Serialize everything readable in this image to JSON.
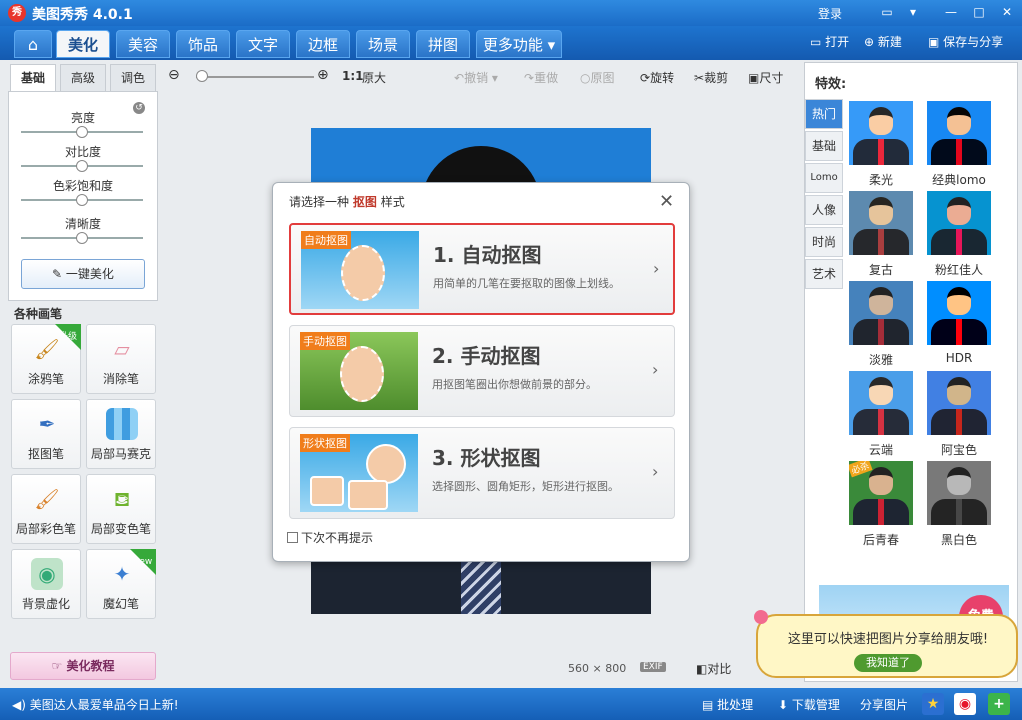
{
  "window": {
    "logo": "秀",
    "title": "美图秀秀 4.0.1",
    "login": "登录",
    "icons": [
      "message-icon",
      "dropdown-icon",
      "minimize-icon",
      "maximize-icon",
      "close-icon"
    ]
  },
  "tabs": [
    {
      "label": "⌂"
    },
    {
      "label": "美化"
    },
    {
      "label": "美容"
    },
    {
      "label": "饰品"
    },
    {
      "label": "文字"
    },
    {
      "label": "边框"
    },
    {
      "label": "场景"
    },
    {
      "label": "拼图"
    },
    {
      "label": "更多功能"
    }
  ],
  "top_actions": {
    "open": "打开",
    "new": "新建",
    "save_share": "保存与分享"
  },
  "toolbar": {
    "ratio": "1:1",
    "original_size": "原大",
    "undo": "撤销",
    "redo": "重做",
    "original": "原图",
    "rotate": "旋转",
    "crop": "裁剪",
    "size": "尺寸",
    "zoom_level": 0.05
  },
  "left": {
    "subtabs": [
      "基础",
      "高级",
      "调色"
    ],
    "adjustments": [
      {
        "label": "亮度",
        "value": 0.5
      },
      {
        "label": "对比度",
        "value": 0.5
      },
      {
        "label": "色彩饱和度",
        "value": 0.5
      },
      {
        "label": "清晰度",
        "value": 0.5
      }
    ],
    "onekey": "一键美化",
    "brush_title": "各种画笔",
    "brushes": [
      {
        "label": "涂鸦笔",
        "badge": "升级"
      },
      {
        "label": "消除笔",
        "badge": ""
      },
      {
        "label": "抠图笔",
        "badge": ""
      },
      {
        "label": "局部马赛克",
        "badge": ""
      },
      {
        "label": "局部彩色笔",
        "badge": ""
      },
      {
        "label": "局部变色笔",
        "badge": ""
      },
      {
        "label": "背景虚化",
        "badge": ""
      },
      {
        "label": "魔幻笔",
        "badge": "new"
      }
    ],
    "tutorial": "美化教程"
  },
  "canvas": {
    "width": "560",
    "times": "×",
    "height": "800",
    "exif": "EXIF",
    "compare": "对比"
  },
  "dialog": {
    "title_pre": "请选择一种",
    "title_hl": "抠图",
    "title_post": "样式",
    "options": [
      {
        "tag": "自动抠图",
        "title": "1. 自动抠图",
        "desc": "用简单的几笔在要抠取的图像上划线。"
      },
      {
        "tag": "手动抠图",
        "title": "2. 手动抠图",
        "desc": "用抠图笔圈出你想做前景的部分。"
      },
      {
        "tag": "形状抠图",
        "title": "3. 形状抠图",
        "desc": "选择圆形、圆角矩形，矩形进行抠图。"
      }
    ],
    "checkbox": "下次不再提示"
  },
  "right": {
    "title": "特效:",
    "categories": [
      "热门",
      "基础",
      "Lomo",
      "人像",
      "时尚",
      "艺术"
    ],
    "effects": [
      {
        "label": "柔光",
        "badge": ""
      },
      {
        "label": "经典lomo",
        "badge": ""
      },
      {
        "label": "复古",
        "badge": ""
      },
      {
        "label": "粉红佳人",
        "badge": ""
      },
      {
        "label": "淡雅",
        "badge": ""
      },
      {
        "label": "HDR",
        "badge": ""
      },
      {
        "label": "云端",
        "badge": ""
      },
      {
        "label": "阿宝色",
        "badge": ""
      },
      {
        "label": "后青春",
        "badge": "必杀"
      },
      {
        "label": "黑白色",
        "badge": ""
      }
    ],
    "banner_text": "免费"
  },
  "bubble": {
    "text": "这里可以快速把图片分享给朋友哦!",
    "button": "我知道了"
  },
  "status": {
    "message": "美图达人最爱单品今日上新!",
    "batch": "批处理",
    "download": "下载管理",
    "share": "分享图片"
  }
}
